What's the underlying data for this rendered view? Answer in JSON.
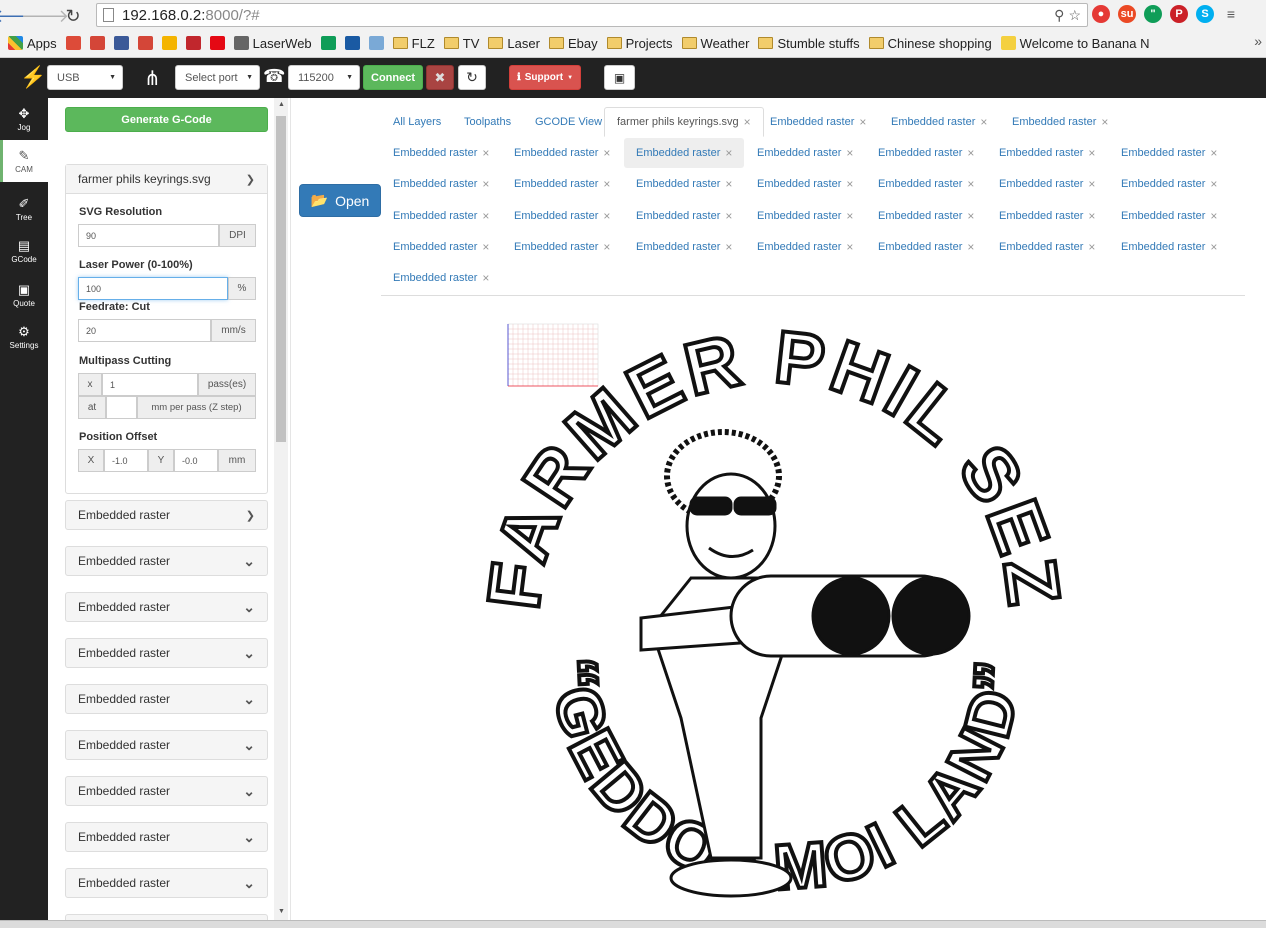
{
  "browser": {
    "url_host": "192.168.0.2:",
    "url_rest": "8000/?#",
    "bookmarks": [
      {
        "label": "Apps",
        "kind": "apps"
      },
      {
        "label": "",
        "kind": "fav",
        "color": "#dd4b39"
      },
      {
        "label": "",
        "kind": "fav",
        "color": "#d44638"
      },
      {
        "label": "",
        "kind": "fav",
        "color": "#3b5998"
      },
      {
        "label": "",
        "kind": "fav",
        "color": "#d44638"
      },
      {
        "label": "",
        "kind": "fav",
        "color": "#f4b400"
      },
      {
        "label": "",
        "kind": "fav",
        "color": "#c1272d"
      },
      {
        "label": "",
        "kind": "fav",
        "color": "#e50914"
      },
      {
        "label": "LaserWeb",
        "kind": "fav",
        "color": "#666666"
      },
      {
        "label": "",
        "kind": "fav",
        "color": "#0f9d58"
      },
      {
        "label": "",
        "kind": "fav",
        "color": "#1a5aa3"
      },
      {
        "label": "",
        "kind": "fav",
        "color": "#7aa9d6"
      },
      {
        "label": "FLZ",
        "kind": "folder"
      },
      {
        "label": "TV",
        "kind": "folder"
      },
      {
        "label": "Laser",
        "kind": "folder"
      },
      {
        "label": "Ebay",
        "kind": "folder"
      },
      {
        "label": "Projects",
        "kind": "folder"
      },
      {
        "label": "Weather",
        "kind": "folder"
      },
      {
        "label": "Stumble stuffs",
        "kind": "folder"
      },
      {
        "label": "Chinese shopping",
        "kind": "folder"
      },
      {
        "label": "Welcome to Banana N",
        "kind": "fav",
        "color": "#f4d03f"
      }
    ]
  },
  "toolbar": {
    "connection_type": "USB",
    "port_placeholder": "Select port",
    "baud": "115200",
    "connect_label": "Connect",
    "support_label": "Support"
  },
  "sidebar": [
    {
      "label": "Jog",
      "icon": "jog-icon",
      "glyph": "✥"
    },
    {
      "label": "CAM",
      "icon": "cam-icon",
      "glyph": "✎",
      "active": true
    },
    {
      "label": "Tree",
      "icon": "tree-icon",
      "glyph": "✐"
    },
    {
      "label": "GCode",
      "icon": "gcode-icon",
      "glyph": "▤"
    },
    {
      "label": "Quote",
      "icon": "quote-icon",
      "glyph": "▣"
    },
    {
      "label": "Settings",
      "icon": "settings-icon",
      "glyph": "⚙"
    }
  ],
  "cam": {
    "generate_label": "Generate G-Code",
    "file_name": "farmer phils keyrings.svg",
    "svg_res_label": "SVG Resolution",
    "svg_res_value": "90",
    "svg_res_unit": "DPI",
    "laser_power_label": "Laser Power (0-100%)",
    "laser_power_value": "100",
    "laser_power_unit": "%",
    "feedrate_label": "Feedrate: Cut",
    "feedrate_value": "20",
    "feedrate_unit": "mm/s",
    "multipass_label": "Multipass Cutting",
    "passes_prefix": "x",
    "passes_value": "1",
    "passes_unit": "pass(es)",
    "zstep_prefix": "at",
    "zstep_value": "",
    "zstep_unit": "mm per pass (Z step)",
    "offset_label": "Position Offset",
    "offset_x_label": "X",
    "offset_x_value": "-1.0",
    "offset_y_label": "Y",
    "offset_y_value": "-0.0",
    "offset_unit": "mm",
    "raster_items": [
      "Embedded raster",
      "Embedded raster",
      "Embedded raster",
      "Embedded raster",
      "Embedded raster",
      "Embedded raster",
      "Embedded raster",
      "Embedded raster",
      "Embedded raster",
      "Embedded raster"
    ]
  },
  "main": {
    "open_label": "Open",
    "tabs_row1": [
      "All Layers",
      "Toolpaths",
      "GCODE View",
      "farmer phils keyrings.svg",
      "Embedded raster",
      "Embedded raster",
      "Embedded raster"
    ],
    "raster_tab_label": "Embedded raster",
    "raster_tab_count": 32
  },
  "artwork": {
    "top_text": "FARMER PHIL SEZ",
    "bottom_text": "“GEDDON MOI LAND”"
  }
}
